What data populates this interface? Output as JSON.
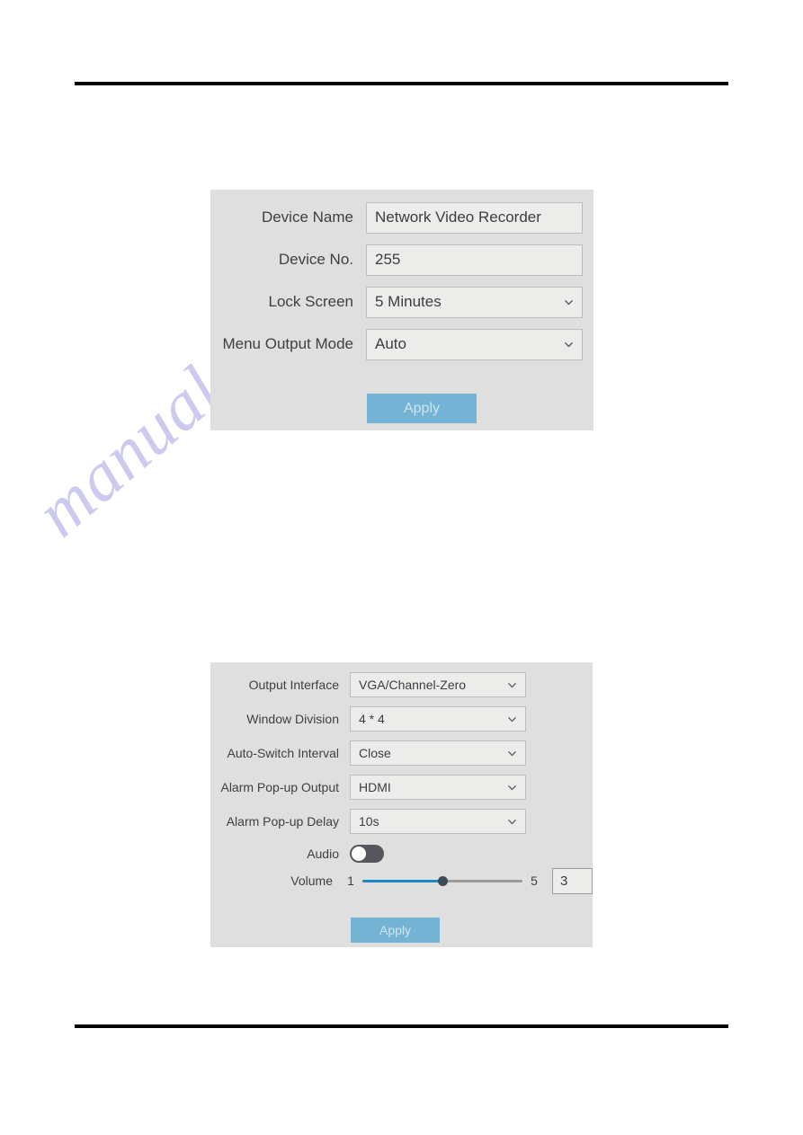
{
  "page": {
    "watermark": "manualshive.com",
    "header_rule": true,
    "footer_rule": true
  },
  "device_settings_panel": {
    "rows": [
      {
        "label": "Device Name",
        "value": "Network Video Recorder",
        "control": "text"
      },
      {
        "label": "Device No.",
        "value": "255",
        "control": "text"
      },
      {
        "label": "Lock Screen",
        "value": "5 Minutes",
        "control": "select"
      },
      {
        "label": "Menu Output Mode",
        "value": "Auto",
        "control": "select"
      }
    ],
    "apply_label": "Apply"
  },
  "live_view_panel": {
    "rows": [
      {
        "label": "Output Interface",
        "value": "VGA/Channel-Zero",
        "control": "select"
      },
      {
        "label": "Window Division",
        "value": "4 * 4",
        "control": "select"
      },
      {
        "label": "Auto-Switch Interval",
        "value": "Close",
        "control": "select"
      },
      {
        "label": "Alarm Pop-up Output",
        "value": "HDMI",
        "control": "select"
      },
      {
        "label": "Alarm Pop-up Delay",
        "value": "10s",
        "control": "select"
      }
    ],
    "audio": {
      "label": "Audio",
      "state": "off"
    },
    "volume": {
      "label": "Volume",
      "min": "1",
      "max": "5",
      "value": "3",
      "fill_percent": 50
    },
    "apply_label": "Apply"
  },
  "colors": {
    "panel_bg": "#e0dfdf",
    "field_bg": "#ececeb",
    "field_border": "#bdbdbd",
    "apply_bg": "#74b3d4",
    "apply_text": "#cfe4f1",
    "slider_fill": "#1f88c4",
    "slider_rail": "#9a9a9a",
    "toggle_off": "#57565c",
    "watermark": "#b9b7e8"
  }
}
